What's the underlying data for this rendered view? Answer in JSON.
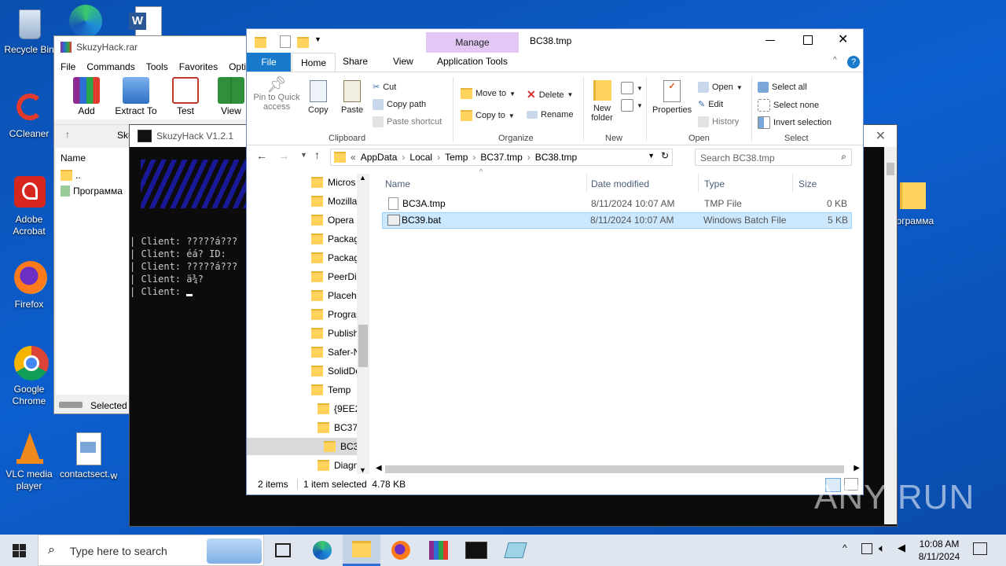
{
  "desktop": {
    "icons": [
      {
        "label": "Recycle Bin"
      },
      {
        "label": "CCleaner"
      },
      {
        "label": "Adobe Acrobat"
      },
      {
        "label": "Firefox"
      },
      {
        "label": "Google Chrome"
      },
      {
        "label": "VLC media player"
      },
      {
        "label": "contactsect..."
      },
      {
        "label": "w"
      },
      {
        "label": "рограмма"
      }
    ]
  },
  "rar": {
    "title": "SkuzyHack.rar",
    "menu": [
      "File",
      "Commands",
      "Tools",
      "Favorites",
      "Optio"
    ],
    "toolbar": [
      "Add",
      "Extract To",
      "Test",
      "View"
    ],
    "path_prefix": "Sku",
    "col_name": "Name",
    "files": [
      "..",
      "Программа"
    ],
    "status": "Selected"
  },
  "console": {
    "title": "SkuzyHack V1.2.1",
    "lines": [
      "| Client: ?????á???",
      "| Client: éá? ID:",
      "| Client: ?????á???",
      "| Client: ä¾? ",
      "| Client: "
    ]
  },
  "explorer": {
    "title": "BC38.tmp",
    "manage_tab": "Manage",
    "app_tools_tab": "Application Tools",
    "tabs": [
      "File",
      "Home",
      "Share",
      "View"
    ],
    "ribbon": {
      "pin": "Pin to Quick access",
      "copy": "Copy",
      "paste": "Paste",
      "cut": "Cut",
      "copy_path": "Copy path",
      "paste_shortcut": "Paste shortcut",
      "move_to": "Move to",
      "copy_to": "Copy to",
      "delete": "Delete",
      "rename": "Rename",
      "new_folder": "New folder",
      "properties": "Properties",
      "open": "Open",
      "edit": "Edit",
      "history": "History",
      "select_all": "Select all",
      "select_none": "Select none",
      "invert_selection": "Invert selection",
      "groups": [
        "Clipboard",
        "Organize",
        "New",
        "Open",
        "Select"
      ]
    },
    "address": {
      "chevron": "«",
      "crumbs": [
        "AppData",
        "Local",
        "Temp",
        "BC37.tmp",
        "BC38.tmp"
      ],
      "search_placeholder": "Search BC38.tmp"
    },
    "tree": [
      "Micros",
      "Mozilla",
      "Opera",
      "Packag",
      "Packag",
      "PeerDis",
      "Placeh",
      "Progran",
      "Publish",
      "Safer-N",
      "SolidDo",
      "Temp",
      "{9EE2!",
      "BC37.",
      "BC3",
      "Diagn"
    ],
    "columns": [
      "Name",
      "Date modified",
      "Type",
      "Size"
    ],
    "files": [
      {
        "name": "BC3A.tmp",
        "date": "8/11/2024 10:07 AM",
        "type": "TMP File",
        "size": "0 KB"
      },
      {
        "name": "BC39.bat",
        "date": "8/11/2024 10:07 AM",
        "type": "Windows Batch File",
        "size": "5 KB"
      }
    ],
    "status": {
      "items": "2 items",
      "selected": "1 item selected  4.78 KB"
    }
  },
  "taskbar": {
    "search_placeholder": "Type here to search",
    "time": "10:08 AM",
    "date": "8/11/2024"
  },
  "watermark": "ANY RUN",
  "colors": {
    "desktop": "#0c5fcf",
    "selection": "#cce8ff",
    "accent": "#1979ca"
  }
}
